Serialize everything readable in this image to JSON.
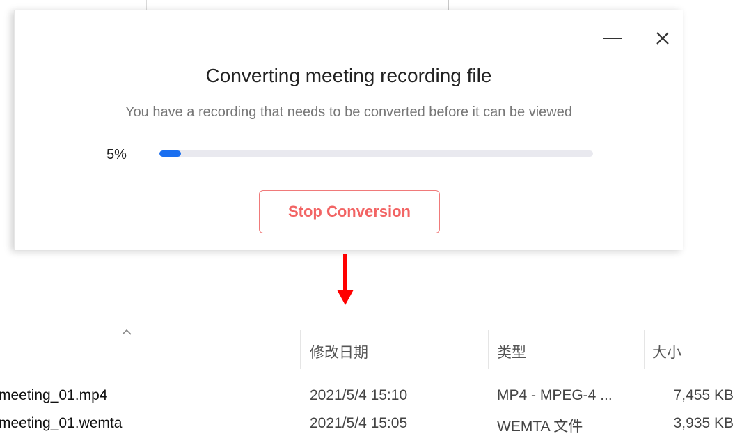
{
  "dialog": {
    "title": "Converting meeting recording file",
    "description": "You have a recording that needs to be converted before it can be viewed",
    "progress_label": "5%",
    "progress_fraction": 0.05,
    "stop_button_label": "Stop Conversion",
    "minimize_icon": "minimize-icon",
    "close_icon": "close-icon"
  },
  "arrow": {
    "color": "#ff0000",
    "icon": "down-arrow-icon"
  },
  "explorer": {
    "sort_indicator_icon": "sort-ascending-caret-icon",
    "columns": {
      "date": "修改日期",
      "type": "类型",
      "size": "大小"
    },
    "rows": [
      {
        "name": "meeting_01.mp4",
        "date": "2021/5/4 15:10",
        "type": "MP4 - MPEG-4 ...",
        "size": "7,455 KB"
      },
      {
        "name": "meeting_01.wemta",
        "date": "2021/5/4 15:05",
        "type": "WEMTA 文件",
        "size": "3,935 KB"
      }
    ]
  },
  "colors": {
    "progress_fill": "#1a6ff0",
    "stop_button": "#f26464",
    "arrow": "#ff0000"
  }
}
